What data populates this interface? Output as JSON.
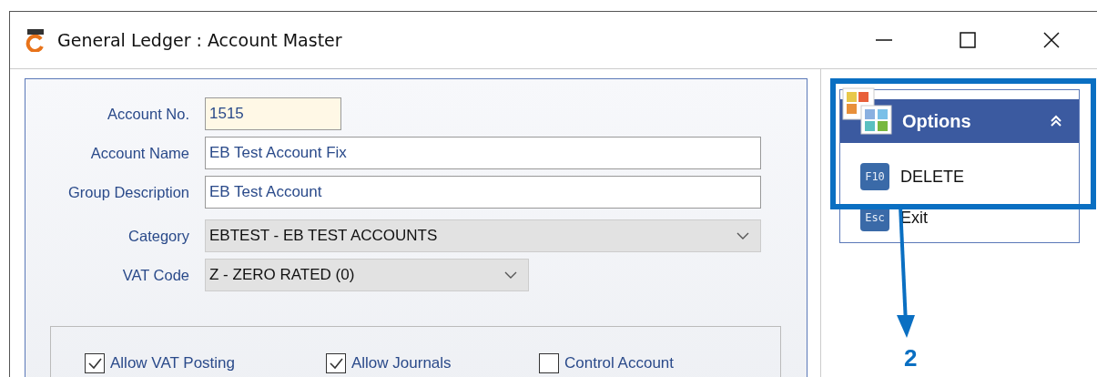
{
  "window": {
    "title": "General Ledger : Account Master"
  },
  "form": {
    "fields": [
      {
        "label": "Account No.",
        "value": "1515",
        "kind": "key"
      },
      {
        "label": "Account Name",
        "value": "EB Test Account Fix",
        "kind": "text"
      },
      {
        "label": "Group Description",
        "value": "EB Test Account",
        "kind": "text"
      },
      {
        "label": "Category",
        "value": "EBTEST - EB TEST ACCOUNTS",
        "kind": "dropdown-wide"
      },
      {
        "label": "VAT Code",
        "value": "Z - ZERO RATED (0)",
        "kind": "dropdown"
      }
    ],
    "checkboxes": [
      {
        "label": "Allow VAT Posting",
        "checked": true
      },
      {
        "label": "Allow Journals",
        "checked": true
      },
      {
        "label": "Control Account",
        "checked": false
      }
    ]
  },
  "options": {
    "title": "Options",
    "expanded": true,
    "items": [
      {
        "key": "F10",
        "label": "DELETE"
      },
      {
        "key": "Esc",
        "label": "Exit"
      }
    ]
  },
  "callout": {
    "number": "2"
  }
}
